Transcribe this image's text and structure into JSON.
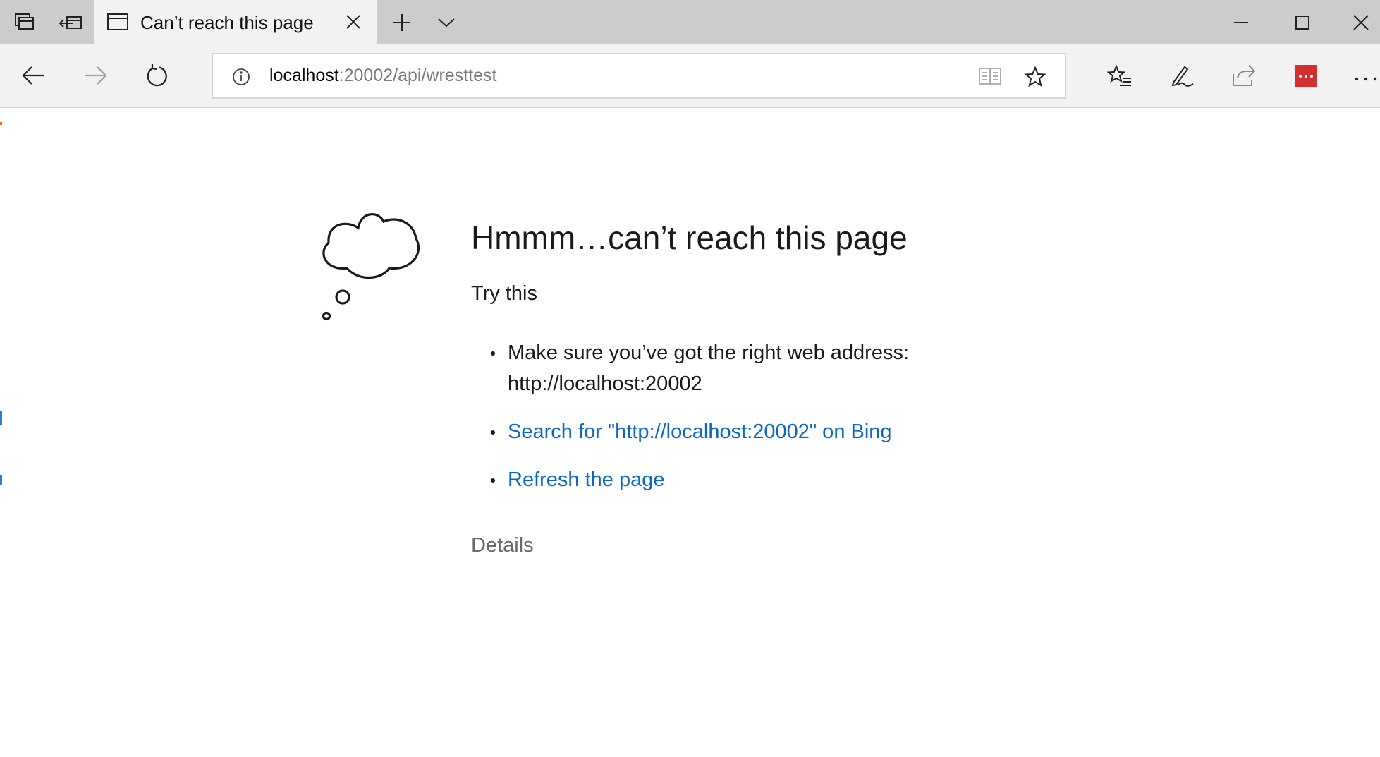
{
  "window": {
    "tab_title": "Can’t reach this page",
    "tab_actions": [
      "tab-preview-icon",
      "set-tabs-aside-icon",
      "new-tab-icon",
      "tab-list-icon"
    ],
    "window_controls": [
      "minimize-icon",
      "maximize-icon",
      "close-icon"
    ]
  },
  "navbar": {
    "address": {
      "host": "localhost",
      "path": ":20002/api/wresttest"
    },
    "nav_icons": [
      "back-icon",
      "forward-icon",
      "refresh-icon"
    ],
    "tool_icons": [
      "favorites-icon",
      "web-note-icon",
      "share-icon",
      "lastpass-icon",
      "more-icon"
    ]
  },
  "error_page": {
    "heading": "Hmmm…can’t reach this page",
    "try_this": "Try this",
    "suggestion_1": "Make sure you’ve got the right web address: http://localhost:20002",
    "suggestion_2_link": "Search for \"http://localhost:20002\" on Bing",
    "suggestion_3_link": "Refresh the page",
    "details": "Details"
  },
  "colors": {
    "link": "#0a67c2",
    "titlebar": "#cccccc",
    "toolbar": "#f2f2f2",
    "lastpass": "#d32f2f"
  }
}
